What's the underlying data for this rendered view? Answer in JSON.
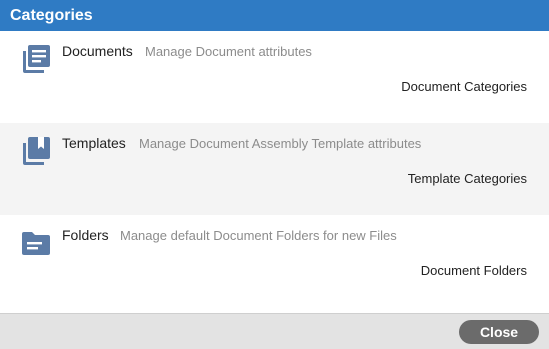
{
  "header": {
    "title": "Categories"
  },
  "sections": [
    {
      "title": "Documents",
      "description": "Manage Document attributes",
      "link": "Document Categories",
      "icon": "documents-icon"
    },
    {
      "title": "Templates",
      "description": "Manage Document Assembly Template attributes",
      "link": "Template Categories",
      "icon": "templates-icon"
    },
    {
      "title": "Folders",
      "description": "Manage default Document Folders for new Files",
      "link": "Document Folders",
      "icon": "folder-icon"
    }
  ],
  "footer": {
    "close_label": "Close"
  },
  "colors": {
    "header_bg": "#2f7bc4",
    "icon": "#5b7ba6",
    "alt_row": "#f4f4f4",
    "button_bg": "#6b6b6b"
  }
}
